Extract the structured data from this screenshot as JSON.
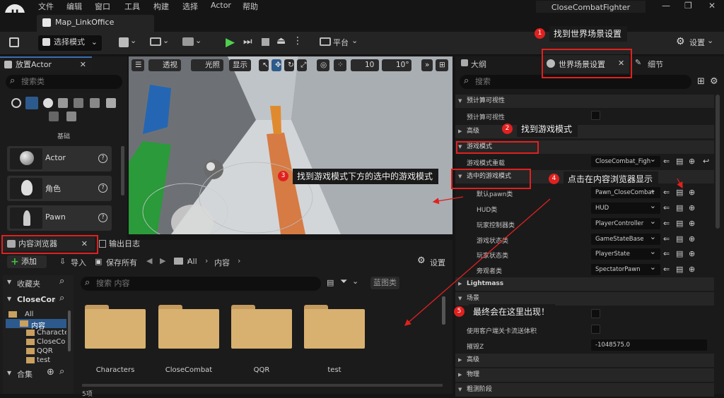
{
  "app": {
    "logo": "U",
    "menu": [
      "文件",
      "编辑",
      "窗口",
      "工具",
      "构建",
      "选择",
      "Actor",
      "帮助"
    ],
    "project_title": "CloseCombatFighter",
    "map_tab": "Map_LinkOffice",
    "window_controls": [
      "—",
      "❐",
      "✕"
    ]
  },
  "toolbar": {
    "select_mode": "选择模式",
    "platform": "平台",
    "settings": "设置"
  },
  "place_actor": {
    "title": "放置Actor",
    "search_placeholder": "搜索类",
    "category": "基础",
    "items": [
      "Actor",
      "角色",
      "Pawn"
    ]
  },
  "viewport": {
    "perspective": "透视",
    "lit": "光照",
    "show": "显示",
    "grid_snap": "10",
    "angle_snap": "10°"
  },
  "content_browser": {
    "tab": "内容浏览器",
    "output_log_tab": "输出日志",
    "add": "添加",
    "import": "导入",
    "save_all": "保存所有",
    "breadcrumb": [
      "All",
      "内容"
    ],
    "settings": "设置",
    "favorites": "收藏夹",
    "project_root": "CloseComb",
    "collections": "合集",
    "search_placeholder": "搜索 内容",
    "blueprint_filter": "蓝图类",
    "tree": [
      "All",
      "内容",
      "Characte",
      "CloseCo",
      "QQR",
      "test"
    ],
    "folders": [
      "Characters",
      "CloseCombat",
      "QQR",
      "test"
    ],
    "item_count": "5项"
  },
  "right_panel": {
    "outline_tab": "大纲",
    "world_settings_tab": "世界场景设置",
    "details_tab": "细节",
    "search_placeholder": "搜索",
    "sections": {
      "precomputed_visibility": "预计算可视性",
      "advanced": "高级",
      "game_mode": "游戏模式",
      "selected_game_mode": "选中的游戏模式",
      "lightmass": "Lightmass",
      "scene": "场景",
      "advanced2": "高级",
      "physics": "物理",
      "broadphase": "粗测阶段"
    },
    "props": {
      "precomputed_visibility": "预计算可视性",
      "game_mode_override": "游戏模式重载",
      "game_mode_override_value": "CloseCombat_Figh",
      "default_pawn": "默认pawn类",
      "default_pawn_value": "Pawn_CloseCombat",
      "hud": "HUD类",
      "hud_value": "HUD",
      "player_controller": "玩家控制器类",
      "player_controller_value": "PlayerController",
      "game_state": "游戏状态类",
      "game_state_value": "GameStateBase",
      "player_state": "玩家状态类",
      "player_state_value": "PlayerState",
      "spectator": "旁观者类",
      "spectator_value": "SpectatorPawn",
      "use_client_level_streaming": "使用客户端关卡流送体积",
      "kill_z": "摧毁Z",
      "kill_z_value": "-1048575.0"
    }
  },
  "annotations": [
    {
      "num": "1",
      "text": "找到世界场景设置"
    },
    {
      "num": "2",
      "text": "找到游戏模式"
    },
    {
      "num": "3",
      "text": "找到游戏模式下方的选中的游戏模式"
    },
    {
      "num": "4",
      "text": "点击在内容浏览器显示"
    },
    {
      "num": "5",
      "text": "最终会在这里出现！"
    }
  ],
  "colors": {
    "annotation_red": "#e0211f",
    "accent_green": "#3fbf3f",
    "folder": "#d8b070",
    "selected_blue": "#2d5a8c"
  }
}
